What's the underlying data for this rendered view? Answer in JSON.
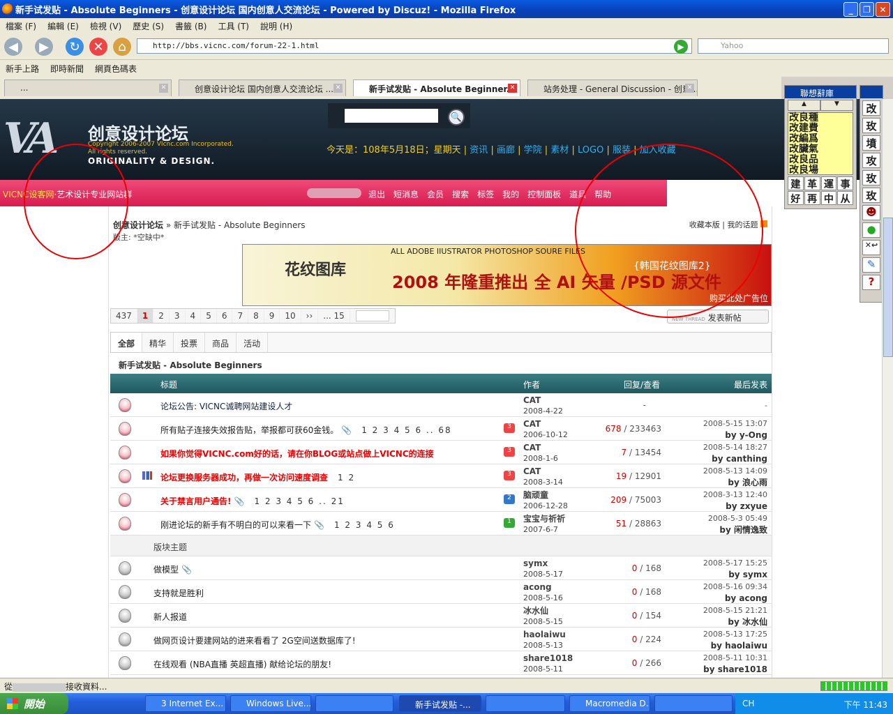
{
  "window": {
    "title": "新手试发贴 - Absolute Beginners - 创意设计论坛 国内创意人交流论坛 - Powered by Discuz! - Mozilla Firefox"
  },
  "menu": [
    "檔案 (F)",
    "編輯 (E)",
    "檢視 (V)",
    "歷史 (S)",
    "書籤 (B)",
    "工具 (T)",
    "說明 (H)"
  ],
  "address": {
    "url": "http://bbs.vicnc.com/forum-22-1.html",
    "search_placeholder": "Yahoo"
  },
  "bookmarks": [
    "新手上路",
    "即時新聞",
    "網頁色碼表"
  ],
  "tabs": [
    {
      "label": "..."
    },
    {
      "label": "创意设计论坛 国内创意人交流论坛 ..."
    },
    {
      "label": "新手试发贴 - Absolute Beginner..."
    },
    {
      "label": "站务处理 - General Discussion - 创意..."
    }
  ],
  "header": {
    "logo_title": "创意设计论坛",
    "copyright": "Copyright 2006-2007 VIcnc.com Incorporated. All rights reserved.",
    "tagline": "ORIGINALITY & DESIGN.",
    "date_text": "今天是：108年5月18日；星期天",
    "nav": [
      "资讯",
      "画廊",
      "学院",
      "素材",
      "LOGO",
      "服装",
      "加入收藏"
    ]
  },
  "pinkbar": {
    "slogan_brand": "VICNC设客网",
    "slogan_rest": "·艺术设计专业网站群",
    "nav": [
      "退出",
      "短消息",
      "会员",
      "搜索",
      "标签",
      "我的",
      "控制面板",
      "道具",
      "帮助"
    ]
  },
  "forum": {
    "breadcrumb_home": "创意设计论坛",
    "breadcrumb_current": " » 新手试发贴 - Absolute Beginners",
    "moderator": "版主: *空缺中*",
    "right_links": "收藏本版 | 我的话题",
    "banner_top": "ALL ADOBE IIUSTRATOR PHOTOSHOP SOURE FILES",
    "banner_logo": "花纹图库",
    "banner_main": "2008 年隆重推出 全 AI 矢量 /PSD 源文件",
    "banner_side": "{韩国花纹图库2}",
    "banner_buy": "购买此处广告位",
    "pager": [
      "437",
      "1",
      "2",
      "3",
      "4",
      "5",
      "6",
      "7",
      "8",
      "9",
      "10",
      "››",
      "... 15"
    ],
    "new_thread_small": "NEW THREAD",
    "new_thread": "发表新帖",
    "filters": [
      "全部",
      "精华",
      "投票",
      "商品",
      "活动"
    ],
    "title": "新手试发贴 - Absolute Beginners",
    "columns": {
      "subject": "标题",
      "author": "作者",
      "replies": "回复/查看",
      "last": "最后发表"
    },
    "section_label": "版块主题"
  },
  "threads_top": [
    {
      "title": "论坛公告: VICNC诚聘网站建设人才",
      "author": "CAT",
      "date": "2008-4-22",
      "rv": "-",
      "last_time": "-",
      "last_by": "",
      "style": "notice"
    },
    {
      "title": "所有贴子连接失效报告贴，举报都可获60金钱。",
      "pages": "1 2 3 4 5 6 .. 68",
      "clip": true,
      "badge": "3",
      "author": "CAT",
      "date": "2006-10-12",
      "replies": "678",
      "views": "233463",
      "last_time": "2008-5-15 13:07",
      "last_by": "by y-Ong",
      "style": "normal"
    },
    {
      "title": "如果你觉得VICNC.com好的话，请在你BLOG或站点做上VICNC的连接",
      "badge": "3",
      "author": "CAT",
      "date": "2008-1-6",
      "replies": "7",
      "views": "13454",
      "last_time": "2008-5-14 18:27",
      "last_by": "by canthing",
      "style": "red"
    },
    {
      "title": "论坛更换服务器成功，再做一次访问速度调查",
      "pages": "1 2",
      "poll": true,
      "badge": "3",
      "author": "CAT",
      "date": "2008-3-14",
      "replies": "19",
      "views": "12901",
      "last_time": "2008-5-13 14:09",
      "last_by": "by 浪心雨",
      "style": "red"
    },
    {
      "title": "关于禁言用户通告!",
      "pages": "1 2 3 4 5 6 .. 21",
      "clip": true,
      "badge": "2",
      "author": "脑顽童",
      "date": "2006-12-28",
      "replies": "209",
      "views": "75003",
      "last_time": "2008-3-13 12:40",
      "last_by": "by zxyue",
      "style": "red",
      "badge_color": "blue"
    },
    {
      "title": "刚进论坛的新手有不明白的可以来看一下",
      "pages": "1 2 3 4 5 6",
      "clip": true,
      "badge": "1",
      "author": "宝宝与祈祈",
      "date": "2007-6-7",
      "replies": "51",
      "views": "28863",
      "last_time": "2008-5-3 05:49",
      "last_by": "by 闲情逸致",
      "style": "normal",
      "badge_color": "green"
    }
  ],
  "threads": [
    {
      "title": "做模型",
      "clip": true,
      "author": "symx",
      "date": "2008-5-17",
      "replies": "0",
      "views": "168",
      "last_time": "2008-5-17 15:25",
      "last_by": "by symx"
    },
    {
      "title": "支持就是胜利",
      "author": "acong",
      "date": "2008-5-16",
      "replies": "0",
      "views": "168",
      "last_time": "2008-5-16 09:34",
      "last_by": "by acong"
    },
    {
      "title": "新人报道",
      "author": "冰水仙",
      "date": "2008-5-15",
      "replies": "0",
      "views": "154",
      "last_time": "2008-5-15 21:21",
      "last_by": "by 冰水仙"
    },
    {
      "title": "做网页设计要建网站的进来看看了 2G空间送数据库了!",
      "author": "haolaiwu",
      "date": "2008-5-13",
      "replies": "0",
      "views": "224",
      "last_time": "2008-5-13 17:25",
      "last_by": "by haolaiwu"
    },
    {
      "title": "在线观看 (NBA直播 英超直播) 献给论坛的朋友!",
      "author": "share1018",
      "date": "2008-5-11",
      "replies": "0",
      "views": "266",
      "last_time": "2008-5-11 10:31",
      "last_by": "by share1018"
    }
  ],
  "ime": {
    "title": "聯想辭庫",
    "candidates": [
      "改良種",
      "改建費",
      "改編爲",
      "改臟氣",
      "改良品",
      "改良場"
    ],
    "grid": [
      "建",
      "革",
      "運",
      "事",
      "好",
      "再",
      "中",
      "从"
    ],
    "keys": [
      "改",
      "玫",
      "墳",
      "攻",
      "玫",
      "玫"
    ]
  },
  "status": {
    "text_prefix": "從",
    "text_suffix": "接收資料..."
  },
  "taskbar": {
    "start": "開始",
    "buttons": [
      "3 Internet Ex...",
      "Windows Live...",
      "",
      "新手试发贴 -...",
      "",
      "Macromedia D...",
      ""
    ],
    "tray_lang": "CH",
    "clock": "下午 11:43"
  }
}
